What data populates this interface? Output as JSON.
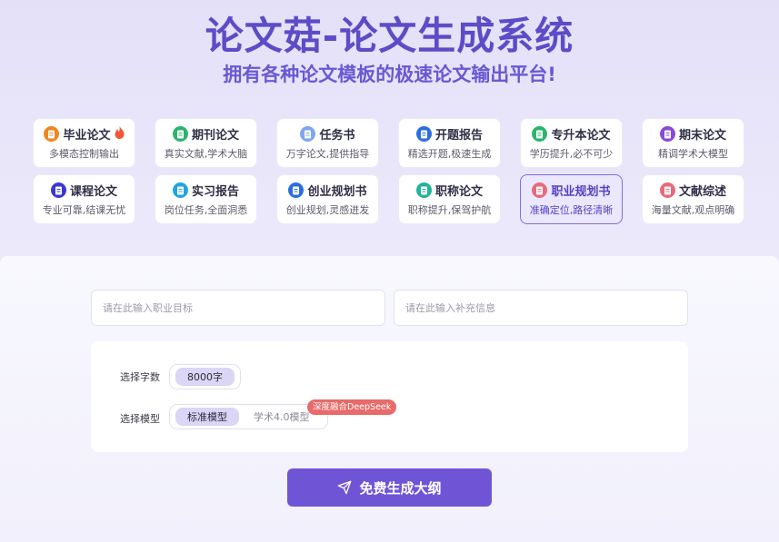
{
  "header": {
    "title": "论文菇-论文生成系统",
    "subtitle": "拥有各种论文模板的极速论文输出平台!"
  },
  "cards": [
    {
      "title": "毕业论文",
      "desc": "多模态控制输出",
      "icon": "document-icon",
      "color": "#f5841f",
      "hot": true
    },
    {
      "title": "期刊论文",
      "desc": "真实文献,学术大脑",
      "icon": "journal-icon",
      "color": "#2cb46e"
    },
    {
      "title": "任务书",
      "desc": "万字论文,提供指导",
      "icon": "task-icon",
      "color": "#7fa6f0"
    },
    {
      "title": "开题报告",
      "desc": "精选开题,极速生成",
      "icon": "report-icon",
      "color": "#2a6de0"
    },
    {
      "title": "专升本论文",
      "desc": "学历提升,必不可少",
      "icon": "book-icon",
      "color": "#2cb46e"
    },
    {
      "title": "期末论文",
      "desc": "精调学术大模型",
      "icon": "exam-icon",
      "color": "#8a49d6"
    },
    {
      "title": "课程论文",
      "desc": "专业可靠,结课无忧",
      "icon": "course-icon",
      "color": "#3a37d6"
    },
    {
      "title": "实习报告",
      "desc": "岗位任务,全面洞悉",
      "icon": "intern-icon",
      "color": "#1fa5e0"
    },
    {
      "title": "创业规划书",
      "desc": "创业规划,灵感迸发",
      "icon": "startup-icon",
      "color": "#2a6de0"
    },
    {
      "title": "职称论文",
      "desc": "职称提升,保驾护航",
      "icon": "title-icon",
      "color": "#21b39a"
    },
    {
      "title": "职业规划书",
      "desc": "准确定位,路径清晰",
      "icon": "career-icon",
      "color": "#e86a7a",
      "active": true
    },
    {
      "title": "文献综述",
      "desc": "海量文献,观点明确",
      "icon": "literature-icon",
      "color": "#e86a7a"
    }
  ],
  "form": {
    "goal_placeholder": "请在此输入职业目标",
    "extra_placeholder": "请在此输入补充信息",
    "wordcount_label": "选择字数",
    "wordcount_selected": "8000字",
    "model_label": "选择模型",
    "model_selected": "标准模型",
    "model_other": "学术4.0模型",
    "model_badge": "深度融合DeepSeek"
  },
  "actions": {
    "generate_label": "免费生成大纲"
  },
  "colors": {
    "accent": "#6f55d6",
    "title": "#5d4bc7",
    "badge": "#e86a6a"
  }
}
